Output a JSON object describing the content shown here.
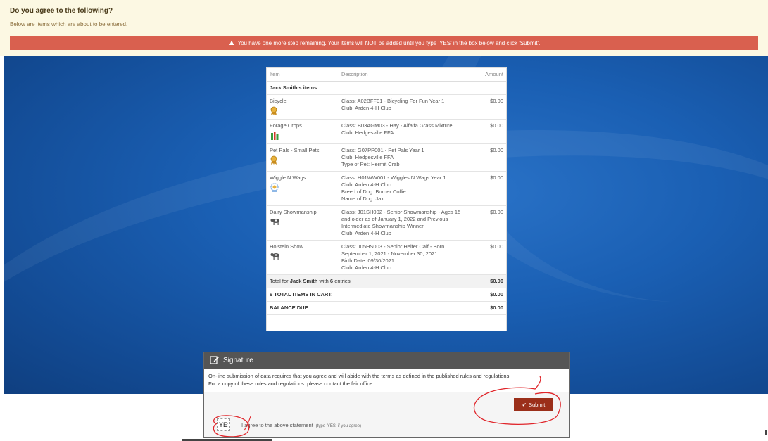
{
  "header": {
    "title": "Do you agree to the following?",
    "subtitle": "Below are items which are about to be entered.",
    "alert": "You have one more step remaining. Your items will NOT be added until you type 'YES' in the box below and click 'Submit'."
  },
  "table": {
    "columns": [
      "Item",
      "Description",
      "Amount"
    ],
    "group_label": "Jack Smith's items:",
    "rows": [
      {
        "item": "Bicycle",
        "icon": "ribbon-icon",
        "desc": [
          "Class: A02BFF01 - Bicycling For Fun Year 1",
          "Club: Arden 4-H Club"
        ],
        "amount": "$0.00"
      },
      {
        "item": "Forage Crops",
        "icon": "plant-icon",
        "desc": [
          "Class: B03AGM03 - Hay - Alfalfa Grass Mixture",
          "Club: Hedgesville FFA"
        ],
        "amount": "$0.00"
      },
      {
        "item": "Pet Pals - Small Pets",
        "icon": "ribbon-icon",
        "desc": [
          "Class: G07PP001 - Pet Pals Year 1",
          "Club: Hedgesville FFA",
          "Type of Pet: Hermit Crab"
        ],
        "amount": "$0.00"
      },
      {
        "item": "Wiggle N Wags",
        "icon": "badge-icon",
        "desc": [
          "Class: H01WW001 - Wiggles N Wags Year 1",
          "Club: Arden 4-H Club",
          "Breed of Dog: Border Collie",
          "Name of Dog: Jax"
        ],
        "amount": "$0.00"
      },
      {
        "item": "Dairy Showmanship",
        "icon": "cow-icon",
        "desc": [
          "Class: J01SH002 - Senior Showmanship - Ages 15",
          "and older as of January 1, 2022 and Previous",
          "Intermediate Showmanship Winner",
          "Club: Arden 4-H Club"
        ],
        "amount": "$0.00"
      },
      {
        "item": "Holstein Show",
        "icon": "cow-icon",
        "desc": [
          "Class: J05HS003 - Senior Heifer Calf - Born",
          "September 1, 2021 - November 30, 2021",
          "Birth Date: 09/30/2021",
          "Club: Arden 4-H Club"
        ],
        "amount": "$0.00"
      }
    ],
    "total_prefix": "Total for",
    "total_name": "Jack Smith",
    "total_with": "with",
    "total_count": "6",
    "total_suffix": "entries",
    "total_amount": "$0.00",
    "cart_label": "6 TOTAL ITEMS IN CART:",
    "cart_amount": "$0.00",
    "balance_label": "BALANCE DUE:",
    "balance_amount": "$0.00"
  },
  "signature": {
    "title": "Signature",
    "body_line1": "On-line submission of data requires that you agree and will abide with the terms as defined in the published rules and regulations.",
    "body_line2": "For a copy of these rules and regulations. please contact the fair office.",
    "submit_label": "Submit",
    "input_value": "YES",
    "agree_text": "I agree to the above statement",
    "agree_hint": "(type 'YES' if you agree)"
  },
  "colors": {
    "alert_bg": "#d9604f",
    "submit_bg": "#9b2f1a",
    "annotation_red": "#e0252a"
  }
}
